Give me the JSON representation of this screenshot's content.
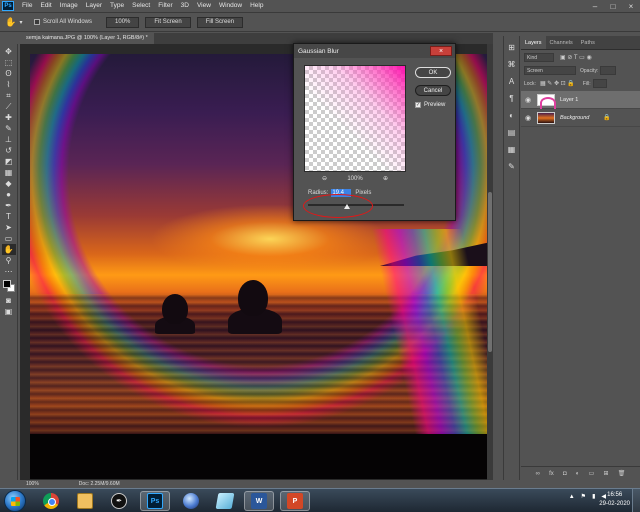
{
  "menubar": {
    "app_logo": "Ps",
    "items": [
      "File",
      "Edit",
      "Image",
      "Layer",
      "Type",
      "Select",
      "Filter",
      "3D",
      "View",
      "Window",
      "Help"
    ],
    "minimize": "–",
    "maximize": "□",
    "close": "×"
  },
  "options": {
    "scroll_all_label": "Scroll All Windows",
    "zoom_btn": "100%",
    "fit_btn": "Fit Screen",
    "fill_btn": "Fill Screen"
  },
  "document": {
    "tab_title": "semja kaimana.JPG @ 100% (Layer 1, RGB/8#) *"
  },
  "status": {
    "zoom": "100%",
    "doc": "Doc: 2.25M/9.60M"
  },
  "layers_panel": {
    "tabs": [
      "Layers",
      "Channels",
      "Paths"
    ],
    "kind_label": "Kind",
    "blend_mode": "Screen",
    "opacity_label": "Opacity:",
    "lock_label": "Lock:",
    "fill_label": "Fill:",
    "layers": [
      {
        "name": "Layer 1"
      },
      {
        "name": "Background"
      }
    ]
  },
  "dialog": {
    "title": "Gaussian Blur",
    "close": "×",
    "ok": "OK",
    "cancel": "Cancel",
    "preview_label": "Preview",
    "preview_checked": true,
    "zoom_out": "⊖",
    "zoom_level": "100%",
    "zoom_in": "⊕",
    "radius_label": "Radius:",
    "radius_value": "19.4",
    "radius_unit": "Pixels"
  },
  "taskbar": {
    "ps_label": "Ps",
    "word_label": "W",
    "ppt_label": "P",
    "time": "16:56",
    "date": "29-02-2020"
  },
  "colors": {
    "rainbow_pink": "#ff00aa",
    "annotation_red": "#e01818",
    "selection_blue": "#3a82e6"
  }
}
